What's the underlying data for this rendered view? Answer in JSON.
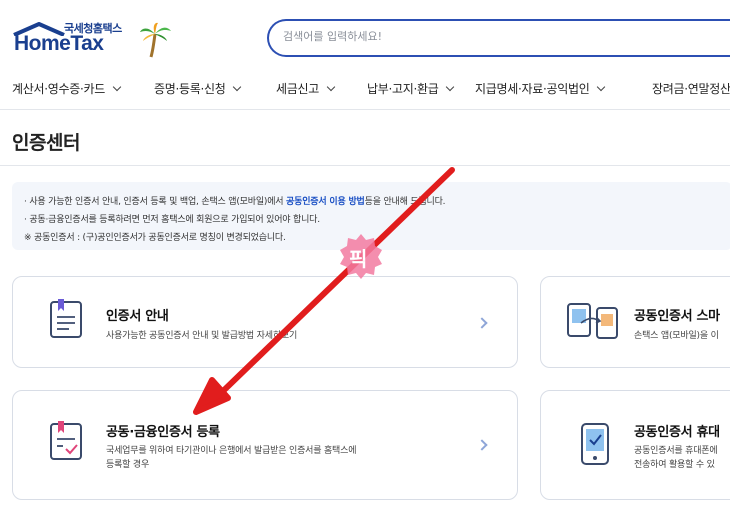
{
  "header": {
    "logo_small": "국세청홈택스",
    "logo_big": "HomeTax",
    "search_placeholder": "검색어를 입력하세요!"
  },
  "nav": {
    "items": [
      {
        "label": "계산서·영수증·카드"
      },
      {
        "label": "증명·등록·신청"
      },
      {
        "label": "세금신고"
      },
      {
        "label": "납부·고지·환급"
      },
      {
        "label": "지급명세·자료·공익법인"
      },
      {
        "label": "장려금·연말정산"
      }
    ]
  },
  "page": {
    "title": "인증센터"
  },
  "notice": {
    "line1_pre": "· 사용 가능한 인증서 안내, 인증서 등록 및 백업, 손택스 앱(모바일)에서 ",
    "line1_link": "공동인증서 이용 방법",
    "line1_post": "등을 안내해 드립니다.",
    "line2": "· 공동·금융인증서를 등록하려면 먼저 홈택스에 회원으로 가입되어 있어야 합니다.",
    "line3": "※ 공동인증서 : (구)공인인증서가 공동인증서로 명칭이 변경되었습니다."
  },
  "cards": [
    {
      "title": "인증서 안내",
      "desc1": "사용가능한 공동인증서 안내 및 발급방법 자세히보기",
      "desc2": "",
      "icon": "document-icon"
    },
    {
      "title": "공동인증서 스마",
      "desc1": "손택스 앱(모바일)을 이",
      "desc2": "",
      "icon": "device-transfer-icon"
    },
    {
      "title": "공동·금융인증서 등록",
      "desc1": "국세업무를 위하여 타기관이나 은행에서 발급받은 인증서를 홈택스에",
      "desc2": "등록할 경우",
      "icon": "certificate-check-icon"
    },
    {
      "title": "공동인증서 휴대",
      "desc1": "공동인증서를 휴대폰에",
      "desc2": "전송하여 활용할 수 있",
      "icon": "phone-check-icon"
    }
  ],
  "overlay": {
    "sticker_text": "픽"
  },
  "colors": {
    "brand": "#1a3f8f",
    "search_border": "#2c4fb3",
    "link": "#1a4fc4",
    "arrow": "#e11d1d",
    "notice_bg": "#f3f6fb"
  }
}
